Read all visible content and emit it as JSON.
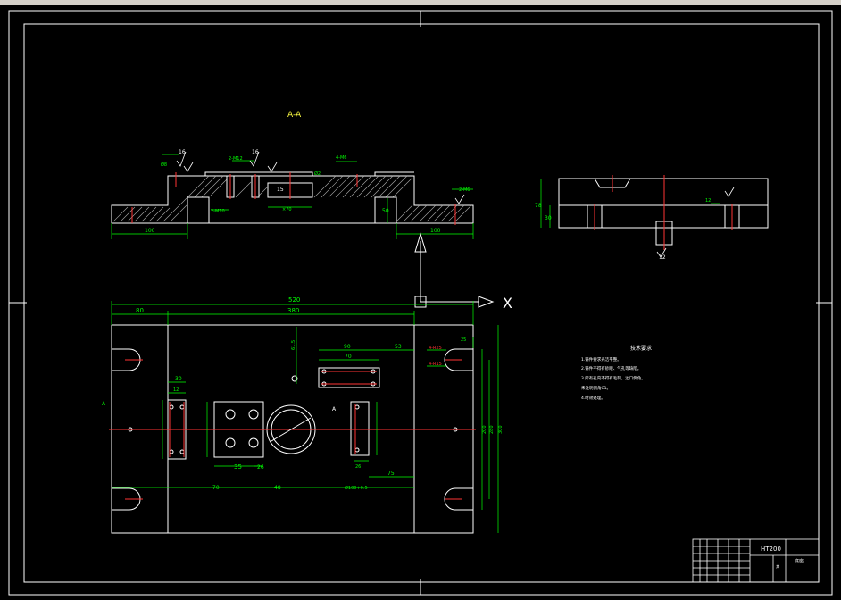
{
  "section": {
    "label": "A-A"
  },
  "axis": {
    "x_label": "X"
  },
  "title_block": {
    "material": "HT200",
    "drawing_no": "底座",
    "cell_left": "其"
  },
  "notes": {
    "title": "技术要求",
    "lines": [
      "1.铸件要求光洁平整。",
      "2.铸件不得有砂眼、气孔等缺陷。",
      "3.所有孔内不得有毛刺，边口倒角。",
      "未注明倒角C1。",
      "4.时效处理。"
    ]
  },
  "dims": {
    "top": {
      "w520": "520",
      "w380": "380",
      "w80": "80"
    },
    "section": {
      "d100a": "100",
      "d100b": "100",
      "d50": "50",
      "h16a": "16",
      "h16b": "16",
      "h15": "15",
      "m12": "2-M12",
      "m10": "2-M10",
      "m6": "4-M6",
      "m6b": "2-M6",
      "d8": "Ø8",
      "d70": "×70",
      "phi2": "Ø2"
    },
    "plan": {
      "d90": "90",
      "d70": "70",
      "d53": "53",
      "d30": "30",
      "d12": "12",
      "d35": "35",
      "d26": "26",
      "d70b": "70",
      "d48": "48",
      "d75": "75",
      "d26b": "26",
      "d25": "25",
      "d200": "200",
      "d280": "280",
      "d300": "300",
      "r25": "4-R25",
      "r15": "4-R15",
      "d5": "Ø100+0.5",
      "a": "A",
      "a2": "A",
      "dd": "61.5"
    },
    "side": {
      "d78": "78",
      "d30": "30",
      "d12": "12",
      "d12b": "12"
    }
  }
}
